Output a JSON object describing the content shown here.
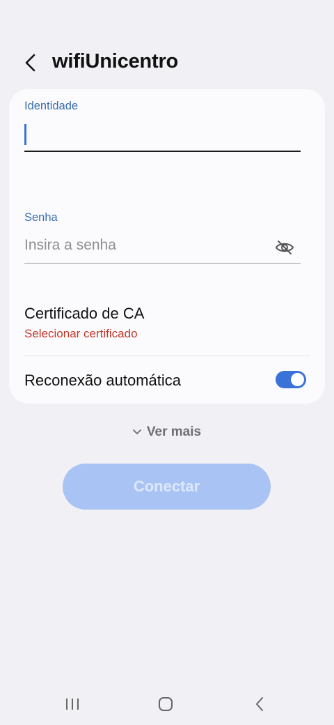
{
  "header": {
    "title": "wifiUnicentro",
    "back_icon": "chevron-left-icon"
  },
  "form": {
    "identity": {
      "label": "Identidade",
      "value": ""
    },
    "password": {
      "label": "Senha",
      "placeholder": "Insira a senha",
      "visibility_icon": "eye-off-icon"
    },
    "certificate": {
      "title": "Certificado de CA",
      "value": "Selecionar certificado"
    },
    "auto_reconnect": {
      "label": "Reconexão automática",
      "enabled": true
    }
  },
  "more": {
    "label": "Ver mais",
    "icon": "chevron-down-icon"
  },
  "actions": {
    "connect_label": "Conectar",
    "connect_enabled": false
  },
  "navigation": {
    "recents_icon": "recents-icon",
    "home_icon": "home-icon",
    "back_icon": "back-icon"
  },
  "colors": {
    "accent": "#3a72d8",
    "label_blue": "#3a6fb0",
    "error_red": "#c0392b",
    "background": "#f1f1f5",
    "card": "#fbfbfd",
    "button_disabled": "#a8c3f4"
  }
}
